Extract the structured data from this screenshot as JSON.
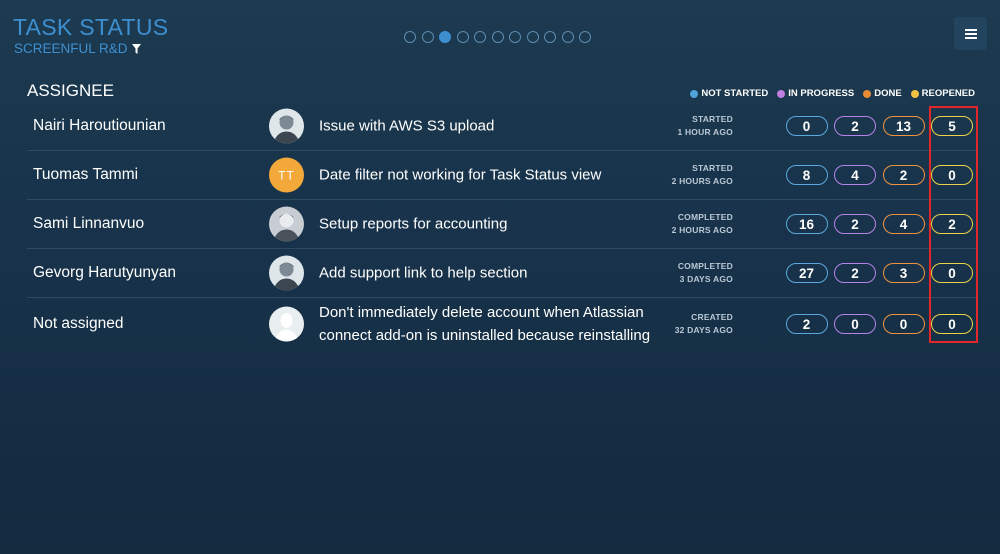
{
  "header": {
    "title": "TASK STATUS",
    "subtitle": "SCREENFUL R&D"
  },
  "pagination": {
    "count": 11,
    "active_index": 2
  },
  "table": {
    "heading": "ASSIGNEE"
  },
  "legend": [
    {
      "label": "NOT STARTED",
      "color": "#4fa3d8"
    },
    {
      "label": "IN PROGRESS",
      "color": "#c37fe0"
    },
    {
      "label": "DONE",
      "color": "#e88b34"
    },
    {
      "label": "REOPENED",
      "color": "#f3c042"
    }
  ],
  "colors": {
    "not_started": "#5aa8dc",
    "in_progress": "#b683e8",
    "done": "#ee9440",
    "reopened": "#ecd246",
    "highlight": "#e3262a",
    "accent": "#3d8fd0"
  },
  "rows": [
    {
      "assignee": "Nairi Haroutiounian",
      "avatar": "photo-icon",
      "task": "Issue with AWS S3 upload",
      "status": "STARTED",
      "when": "1 HOUR AGO",
      "counts": {
        "not_started": "0",
        "in_progress": "2",
        "done": "13",
        "reopened": "5"
      }
    },
    {
      "assignee": "Tuomas Tammi",
      "avatar_initials": "TT",
      "task": "Date filter not working for Task Status view",
      "status": "STARTED",
      "when": "2 HOURS AGO",
      "counts": {
        "not_started": "8",
        "in_progress": "4",
        "done": "2",
        "reopened": "0"
      }
    },
    {
      "assignee": "Sami Linnanvuo",
      "avatar": "photo-icon",
      "task": "Setup reports for accounting",
      "status": "COMPLETED",
      "when": "2 HOURS AGO",
      "counts": {
        "not_started": "16",
        "in_progress": "2",
        "done": "4",
        "reopened": "2"
      }
    },
    {
      "assignee": "Gevorg Harutyunyan",
      "avatar": "photo-icon",
      "task": "Add support link to help section",
      "status": "COMPLETED",
      "when": "3 DAYS AGO",
      "counts": {
        "not_started": "27",
        "in_progress": "2",
        "done": "3",
        "reopened": "0"
      }
    },
    {
      "assignee": "Not assigned",
      "avatar": "default-user-icon",
      "task": "Don't immediately delete account when Atlassian connect add-on is uninstalled because reinstalling",
      "status": "CREATED",
      "when": "32 DAYS AGO",
      "counts": {
        "not_started": "2",
        "in_progress": "0",
        "done": "0",
        "reopened": "0"
      }
    }
  ]
}
